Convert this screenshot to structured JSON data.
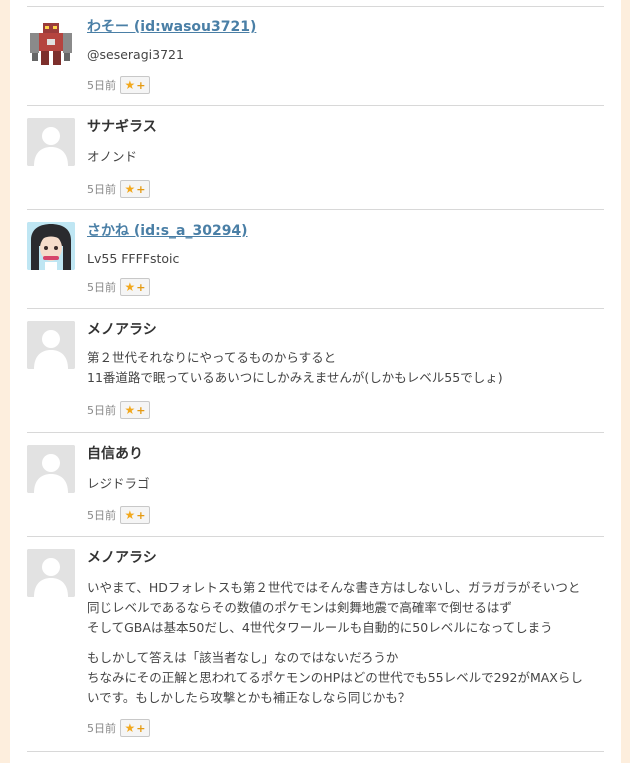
{
  "answers": [
    {
      "name": "わそー (id:wasou3721)",
      "name_style": "link",
      "avatar": "robot-avatar",
      "paragraphs": [
        [
          "@seseragi3721"
        ]
      ],
      "time": "5日前"
    },
    {
      "name": "サナギラス",
      "name_style": "plain",
      "avatar": "default-avatar",
      "paragraphs": [
        [
          "オノンド"
        ]
      ],
      "time": "5日前"
    },
    {
      "name": "さかね (id:s_a_30294)",
      "name_style": "link",
      "avatar": "anime-girl-avatar",
      "paragraphs": [
        [
          "Lv55 FFFFstoic"
        ]
      ],
      "time": "5日前"
    },
    {
      "name": "メノアラシ",
      "name_style": "plain",
      "avatar": "default-avatar",
      "paragraphs": [
        [
          "第２世代それなりにやってるものからすると",
          "11番道路で眠っているあいつにしかみえませんが(しかもレベル55でしょ)"
        ]
      ],
      "time": "5日前"
    },
    {
      "name": "自信あり",
      "name_style": "plain",
      "avatar": "default-avatar",
      "paragraphs": [
        [
          "レジドラゴ"
        ]
      ],
      "time": "5日前"
    },
    {
      "name": "メノアラシ",
      "name_style": "plain",
      "avatar": "default-avatar",
      "paragraphs": [
        [
          "いやまて、HDフォレトスも第２世代ではそんな書き方はしないし、ガラガラがそいつと",
          "同じレベルであるならその数値のポケモンは剣舞地震で高確率で倒せるはず",
          "そしてGBAは基本50だし、4世代タワールールも自動的に50レベルになってしまう"
        ],
        [
          "もしかして答えは「該当者なし」なのではないだろうか",
          "ちなみにその正解と思われてるポケモンのHPはどの世代でも55レベルで292がMAXらし",
          "いです。もしかしたら攻撃とかも補正なしなら同じかも？"
        ]
      ],
      "time": "5日前"
    }
  ],
  "star_button": {
    "star": "★",
    "plus": "+"
  },
  "colors": {
    "link": "#4a7fa6",
    "star": "#f2a81d",
    "page_bg": "#fdeedd"
  }
}
